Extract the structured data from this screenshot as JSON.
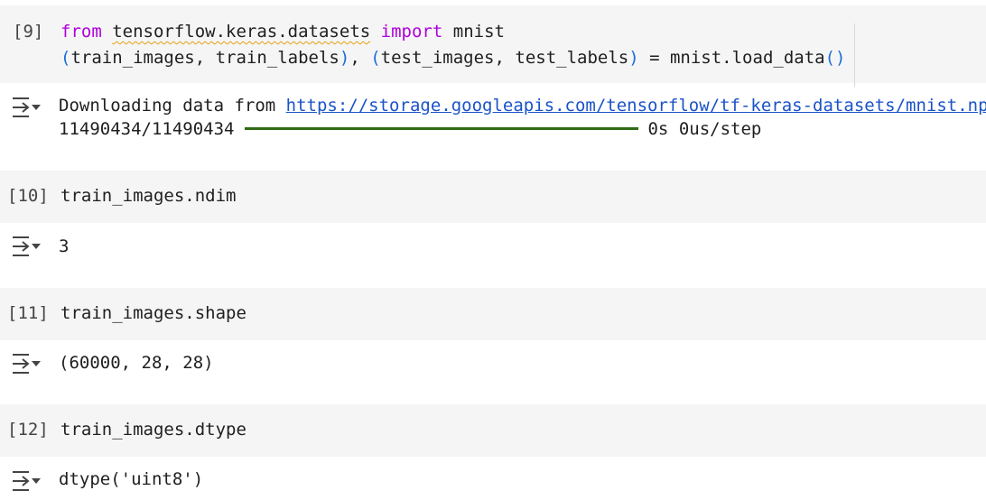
{
  "cells": [
    {
      "exec_count": "[9]",
      "code": {
        "line1_kw_from": "from",
        "line1_module": "tensorflow.keras.datasets",
        "line1_kw_import": "import",
        "line1_name": "mnist",
        "line2_open": "(",
        "line2_mid": "train_images, train_labels",
        "line2_close1": ")",
        "line2_sep": ", ",
        "line2_open2": "(",
        "line2_mid2": "test_images, test_labels",
        "line2_close2": ")",
        "line2_rest": " = mnist.load_data",
        "line2_call": "()"
      },
      "output": {
        "line1_prefix": "Downloading data from ",
        "line1_link": "https://storage.googleapis.com/tensorflow/tf-keras-datasets/mnist.npz",
        "progress_count": "11490434/11490434",
        "progress_fraction": 1.0,
        "progress_time": "0s",
        "progress_rate": "0us/step"
      }
    },
    {
      "exec_count": "[10]",
      "code": "train_images.ndim",
      "output": "3"
    },
    {
      "exec_count": "[11]",
      "code": "train_images.shape",
      "output": "(60000, 28, 28)"
    },
    {
      "exec_count": "[12]",
      "code": "train_images.dtype",
      "output": "dtype('uint8')"
    }
  ],
  "icons": {
    "output_toggle": "output-collapse-icon"
  },
  "colors": {
    "keyword": "#af00db",
    "link": "#1a53c8",
    "progress": "#2e6b14",
    "cell_bg": "#f5f5f5"
  }
}
